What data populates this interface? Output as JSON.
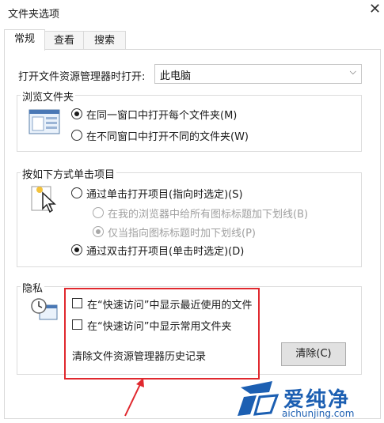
{
  "window": {
    "title": "文件夹选项",
    "close_glyph": "✕"
  },
  "tabs": [
    {
      "label": "常规",
      "active": true
    },
    {
      "label": "查看",
      "active": false
    },
    {
      "label": "搜索",
      "active": false
    }
  ],
  "open_explorer": {
    "label": "打开文件资源管理器时打开:",
    "value": "此电脑"
  },
  "browse_folders": {
    "legend": "浏览文件夹",
    "options": [
      {
        "label": "在同一窗口中打开每个文件夹(M)",
        "selected": true
      },
      {
        "label": "在不同窗口中打开不同的文件夹(W)",
        "selected": false
      }
    ]
  },
  "click_items": {
    "legend": "按如下方式单击项目",
    "single_click": {
      "label": "通过单击打开项目(指向时选定)(S)",
      "selected": false
    },
    "sub_options": [
      {
        "label": "在我的浏览器中给所有图标标题加下划线(B)",
        "selected": false
      },
      {
        "label": "仅当指向图标标题时加下划线(P)",
        "selected": true
      }
    ],
    "double_click": {
      "label": "通过双击打开项目(单击时选定)(D)",
      "selected": true
    }
  },
  "privacy": {
    "legend": "隐私",
    "checkboxes": [
      {
        "label": "在“快速访问”中显示最近使用的文件",
        "checked": false
      },
      {
        "label": "在“快速访问”中显示常用文件夹",
        "checked": false
      }
    ],
    "clear_label": "清除文件资源管理器历史记录",
    "clear_button": "清除(C)"
  },
  "watermark": {
    "name": "爱纯净",
    "url": "aichunjing.com"
  },
  "colors": {
    "highlight": "#e0282e",
    "accent": "#1c5fb2"
  }
}
